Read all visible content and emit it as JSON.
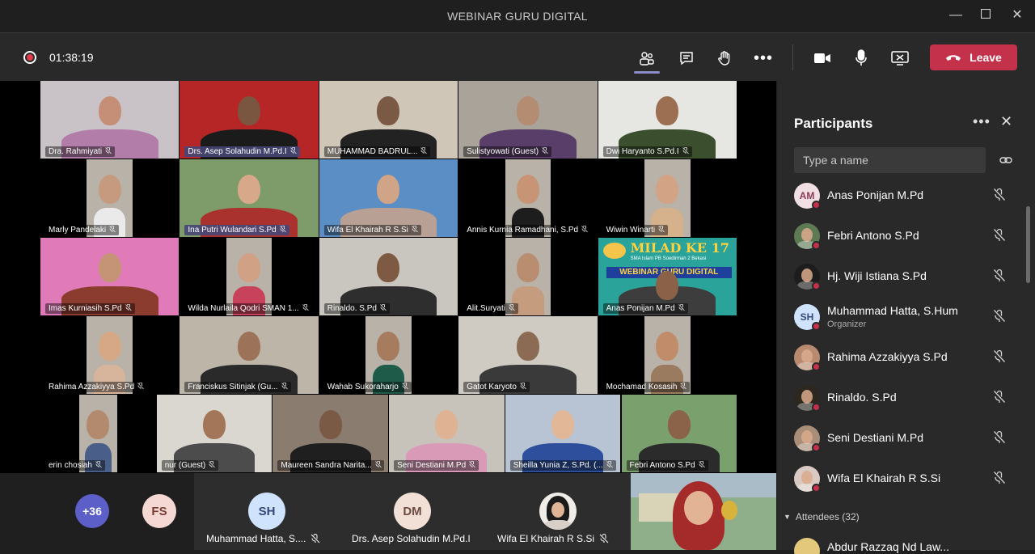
{
  "window": {
    "title": "WEBINAR GURU DIGITAL"
  },
  "toolbar": {
    "timer": "01:38:19",
    "leave_label": "Leave",
    "icons": [
      "people-icon",
      "chat-icon",
      "raise-hand-icon",
      "more-icon",
      "camera-icon",
      "microphone-icon",
      "share-screen-icon"
    ]
  },
  "grid": {
    "rows": [
      [
        {
          "name": "Dra. Rahmiyati",
          "bg": "#c9c2c7",
          "face": "#c58e76",
          "cloth": "#b27ea9"
        },
        {
          "name": "Drs. Asep Solahudin M.Pd.I",
          "bg": "#b72626",
          "face": "#7a5540",
          "cloth": "#1b1b1b",
          "highlight": true
        },
        {
          "name": "MUHAMMAD BADRUL...",
          "bg": "#cfc6b8",
          "face": "#7b5a45",
          "cloth": "#222"
        },
        {
          "name": "Sulistyowati (Guest)",
          "bg": "#a9a39a",
          "face": "#b48c72",
          "cloth": "#5a3e6a"
        },
        {
          "name": "Dwi Haryanto S.Pd.I",
          "bg": "#e6e6e2",
          "face": "#9c6f52",
          "cloth": "#3b4e2e"
        }
      ],
      [
        {
          "name": "Marly Pandelaki",
          "bg": "#000",
          "face": "#c69a7e",
          "cloth": "#eaeaea"
        },
        {
          "name": "Ina Putri Wulandari S.Pd",
          "bg": "#7e9b6a",
          "face": "#d7a889",
          "cloth": "#a9322e",
          "highlight": true
        },
        {
          "name": "Wifa El Khairah R S.Si",
          "bg": "#5c8ec6",
          "face": "#d0a487",
          "cloth": "#b8a095"
        },
        {
          "name": "Annis Kurnia Ramadhani, S.Pd",
          "bg": "#000",
          "face": "#c89476",
          "cloth": "#1d1d1d"
        },
        {
          "name": "Wiwin Winarti",
          "bg": "#000",
          "face": "#d2a384",
          "cloth": "#d5b18c"
        }
      ],
      [
        {
          "name": "Imas Kurniasih S.Pd",
          "bg": "#e07ab8",
          "face": "#c59477",
          "cloth": "#8c3c2e"
        },
        {
          "name": "Wilda Nurlaila Qodri SMAN 1...",
          "bg": "#000",
          "face": "#d0a185",
          "cloth": "#c8425b"
        },
        {
          "name": "Rinaldo. S.Pd",
          "bg": "#c9c6bf",
          "face": "#7e5a42",
          "cloth": "#2e2e2e"
        },
        {
          "name": "Alit.Suryati",
          "bg": "#000",
          "face": "#b98d70",
          "cloth": "#c59c7e"
        },
        {
          "name": "Anas Ponijan M.Pd",
          "bg": "#2aa39a",
          "face": "#8b6148",
          "cloth": "#3d3d3d",
          "banner": "MILAD KE 17",
          "banner_sub": "SMA Islam PB Soedirman 2 Bekasi",
          "banner_title": "WEBINAR GURU DIGITAL"
        }
      ],
      [
        {
          "name": "Rahima Azzakiyya S.Pd",
          "bg": "#000",
          "face": "#d6a886",
          "cloth": "#d7b49c"
        },
        {
          "name": "Franciskus Sitinjak (Gu...",
          "bg": "#bdb5a8",
          "face": "#9c7258",
          "cloth": "#2a2a2a"
        },
        {
          "name": "Wahab Sukoraharjo",
          "bg": "#000",
          "face": "#a67b5e",
          "cloth": "#1f5b49"
        },
        {
          "name": "Gatot Karyoto",
          "bg": "#cfcbc2",
          "face": "#8c6b55",
          "cloth": "#3a3a3a"
        },
        {
          "name": "Mochamad Kosasih",
          "bg": "#000",
          "face": "#c08c6a",
          "cloth": "#9b7b60"
        }
      ],
      [
        {
          "name": "erin chosiah",
          "bg": "#000",
          "face": "#b38a6d",
          "cloth": "#4a5e8a"
        },
        {
          "name": "nur (Guest)",
          "bg": "#d9d7d0",
          "face": "#a37659",
          "cloth": "#4c4c4c"
        },
        {
          "name": "Maureen Sandra Narita...",
          "bg": "#8a7d70",
          "face": "#7b5a45",
          "cloth": "#1f1f1f"
        },
        {
          "name": "Seni Destiani M.Pd",
          "bg": "#c8c3ba",
          "face": "#e0b294",
          "cloth": "#d99ab8"
        },
        {
          "name": "Sheilla Yunia Z, S.Pd. (...",
          "bg": "#b8c3d4",
          "face": "#e2b798",
          "cloth": "#2d4f9c"
        },
        {
          "name": "Febri Antono S.Pd",
          "bg": "#7aa06e",
          "face": "#8b6349",
          "cloth": "#2b2b2b"
        }
      ]
    ]
  },
  "bottom": {
    "overflow_count": "+36",
    "fs_initials": "FS",
    "cells": [
      {
        "initials": "SH",
        "name": "Muhammad Hatta, S....",
        "color": "#cfe3ff",
        "text": "#35497a"
      },
      {
        "initials": "DM",
        "name": "Drs. Asep Solahudin M.Pd.I",
        "color": "#f2dfd6",
        "text": "#6d4c41"
      },
      {
        "initials": "",
        "name": "Wifa El Khairah R S.Si",
        "color": "#f0ece8",
        "text": "#333"
      }
    ]
  },
  "panel": {
    "title": "Participants",
    "search_placeholder": "Type a name",
    "participants": [
      {
        "initials": "AM",
        "name": "Anas Ponijan M.Pd",
        "role": "",
        "avatar_bg": "#f2dfe4",
        "avatar_fg": "#8b3a57"
      },
      {
        "initials": "",
        "name": "Febri Antono S.Pd",
        "role": "",
        "avatar_bg": "#5d7a55",
        "avatar_fg": "#fff"
      },
      {
        "initials": "",
        "name": "Hj. Wiji Istiana S.Pd",
        "role": "",
        "avatar_bg": "#1d1d1d",
        "avatar_fg": "#fff"
      },
      {
        "initials": "SH",
        "name": "Muhammad Hatta, S.Hum",
        "role": "Organizer",
        "avatar_bg": "#cfe3ff",
        "avatar_fg": "#35497a"
      },
      {
        "initials": "",
        "name": "Rahima Azzakiyya S.Pd",
        "role": "",
        "avatar_bg": "#b88a70",
        "avatar_fg": "#fff"
      },
      {
        "initials": "",
        "name": "Rinaldo. S.Pd",
        "role": "",
        "avatar_bg": "#2c2820",
        "avatar_fg": "#fff"
      },
      {
        "initials": "",
        "name": "Seni Destiani M.Pd",
        "role": "",
        "avatar_bg": "#a88d78",
        "avatar_fg": "#fff"
      },
      {
        "initials": "",
        "name": "Wifa El Khairah R S.Si",
        "role": "",
        "avatar_bg": "#d8c9c2",
        "avatar_fg": "#fff"
      }
    ],
    "attendees_label": "Attendees (32)",
    "next_attendee": "Abdur Razzaq Nd Law..."
  }
}
